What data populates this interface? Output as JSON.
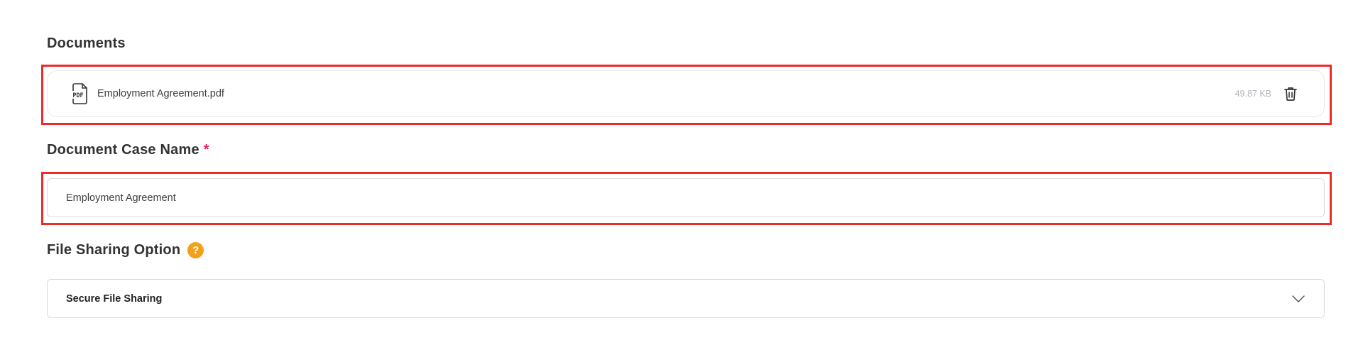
{
  "documents": {
    "title": "Documents",
    "files": [
      {
        "icon": "pdf-file-icon",
        "icon_text": "PDF",
        "name": "Employment Agreement.pdf",
        "size": "49.87 KB",
        "delete_icon": "trash-icon"
      }
    ]
  },
  "case_name": {
    "label": "Document Case Name",
    "required_mark": "*",
    "value": "Employment Agreement"
  },
  "file_sharing": {
    "label": "File Sharing Option",
    "help_icon": "help-icon",
    "help_text": "?",
    "selected": "Secure File Sharing",
    "chevron_icon": "chevron-down-icon"
  },
  "colors": {
    "highlight": "#ee2a2a",
    "required": "#e0245e",
    "help_badge": "#f2a11b"
  }
}
